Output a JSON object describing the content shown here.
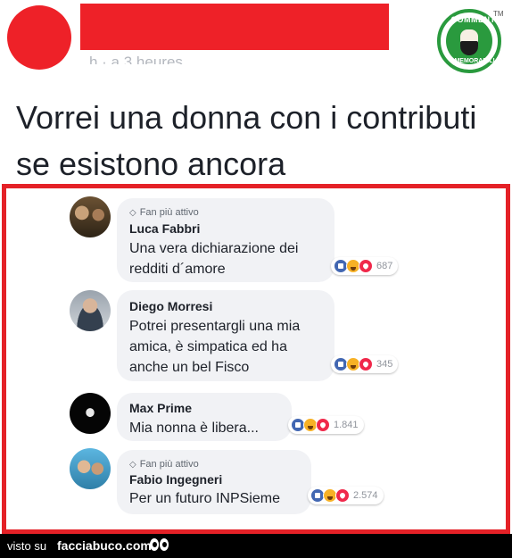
{
  "post": {
    "time_text": "h · a 3 heures",
    "text": "Vorrei una donna con i contributi se esistono ancora"
  },
  "logo": {
    "top_text": "COMMENTI",
    "bottom_text": "MEMORABILI",
    "tm": "TM"
  },
  "comments": [
    {
      "badge": "Fan più attivo",
      "name": "Luca Fabbri",
      "text_lines": [
        "Una vera dichiarazione dei",
        "redditi d´amore"
      ],
      "reaction_count": "687"
    },
    {
      "badge": "",
      "name": "Diego Morresi",
      "text_lines": [
        "Potrei presentargli una mia",
        "amica, è simpatica ed ha",
        "anche un bel Fisco"
      ],
      "reaction_count": "345"
    },
    {
      "badge": "",
      "name": "Max Prime",
      "text_lines": [
        "Mia nonna è libera..."
      ],
      "reaction_count": "1.841"
    },
    {
      "badge": "Fan più attivo",
      "name": "Fabio Ingegneri",
      "text_lines": [
        "Per un futuro INPSieme"
      ],
      "reaction_count": "2.574"
    }
  ],
  "footer": {
    "visto": "visto su",
    "site": "facciabuco.com"
  },
  "colors": {
    "redaction_red": "#ee2128",
    "frame_red": "#e42127",
    "logo_green": "#2a9a3e",
    "like_blue": "#4267b2",
    "bubble_gray": "#f1f2f5"
  }
}
